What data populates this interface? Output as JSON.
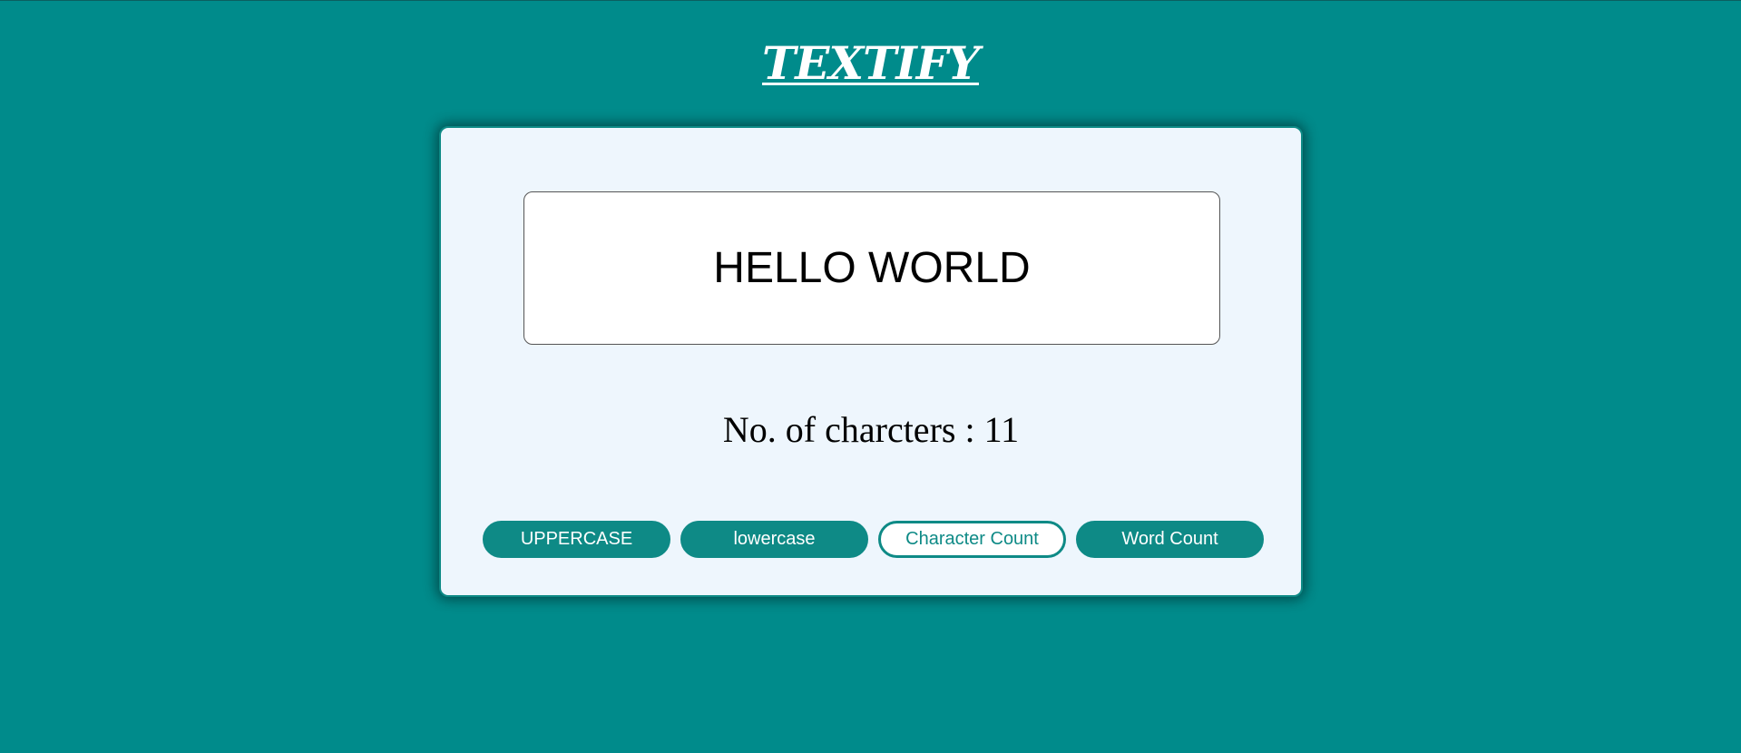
{
  "app": {
    "title": "TEXTIFY"
  },
  "editor": {
    "text": "HELLO WORLD"
  },
  "result": {
    "text": "No. of charcters : 11"
  },
  "buttons": {
    "uppercase": "UPPERCASE",
    "lowercase": "lowercase",
    "char_count": "Character Count",
    "word_count": "Word Count"
  },
  "colors": {
    "background": "#008b8b",
    "card": "#eef6fd",
    "accent": "#0e8a86"
  }
}
